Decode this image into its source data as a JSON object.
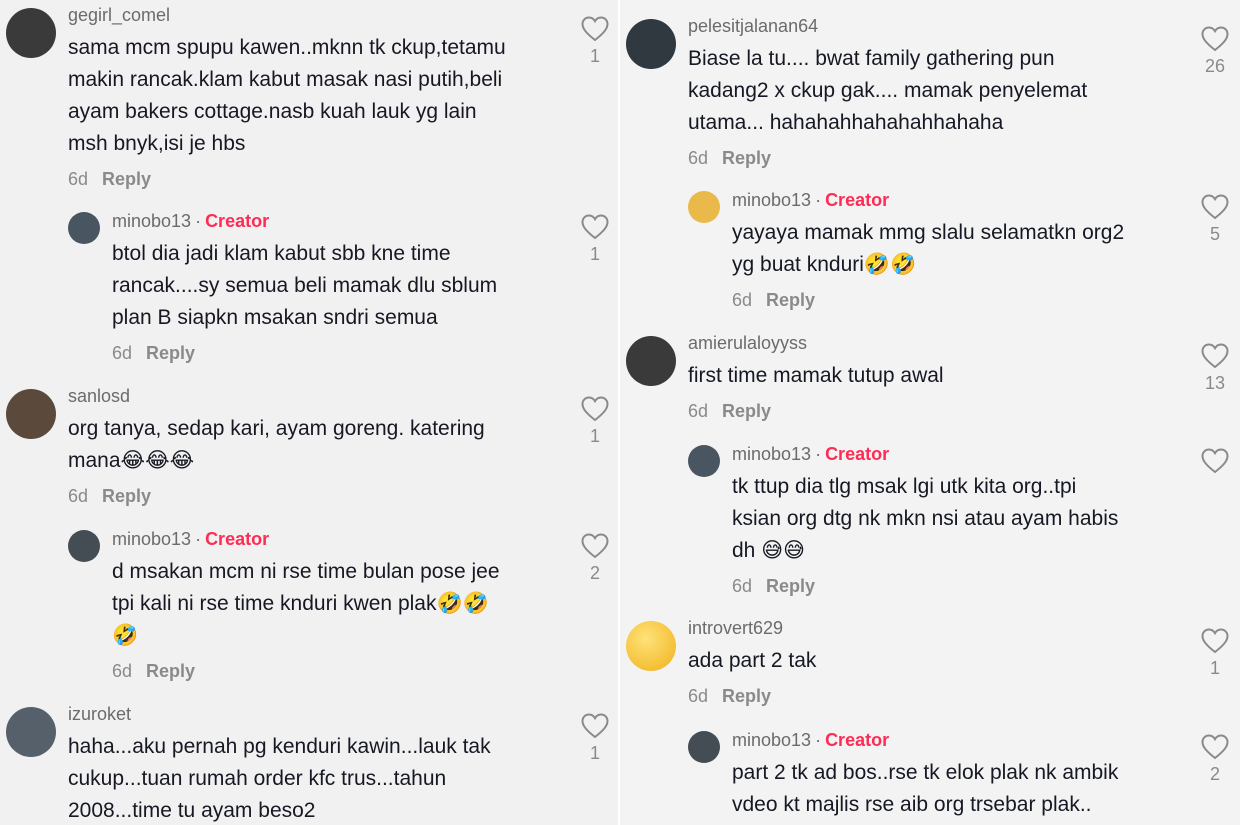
{
  "left": [
    {
      "kind": "top",
      "user": "gegirl_comel",
      "text": "sama mcm spupu kawen..mknn tk ckup,tetamu\nmakin rancak.klam kabut masak nasi putih,beli\nayam bakers cottage.nasb kuah lauk yg lain\nmsh bnyk,isi je hbs",
      "age": "6d",
      "reply": "Reply",
      "likes": "1"
    },
    {
      "kind": "reply",
      "user": "minobo13",
      "creator": "Creator",
      "text": "btol dia jadi klam kabut sbb kne time\nrancak....sy semua beli mamak dlu sblum\nplan B siapkn msakan sndri semua",
      "age": "6d",
      "reply": "Reply",
      "likes": "1"
    },
    {
      "kind": "top",
      "user": "sanlosd",
      "text": "org tanya, sedap kari, ayam goreng. katering\nmana",
      "emoji": "😂😂😂",
      "age": "6d",
      "reply": "Reply",
      "likes": "1"
    },
    {
      "kind": "reply",
      "user": "minobo13",
      "creator": "Creator",
      "text": "d msakan mcm ni rse time bulan pose jee\ntpi kali ni rse time knduri kwen plak",
      "emoji": "🤣🤣\n🤣",
      "age": "6d",
      "reply": "Reply",
      "likes": "2"
    },
    {
      "kind": "top",
      "user": "izuroket",
      "text": "haha...aku pernah pg kenduri kawin...lauk tak\ncukup...tuan rumah order kfc trus...tahun\n2008...time tu ayam beso2",
      "likes": "1"
    }
  ],
  "right": [
    {
      "kind": "top",
      "user": "pelesitjalanan64",
      "text": "Biase la tu.... bwat family gathering pun\nkadang2 x ckup gak.... mamak penyelemat\nutama... hahahahhahahahhahaha",
      "age": "6d",
      "reply": "Reply",
      "likes": "26"
    },
    {
      "kind": "reply",
      "user": "minobo13",
      "creator": "Creator",
      "text": "yayaya mamak mmg slalu selamatkn org2\nyg buat knduri",
      "emoji": "🤣🤣",
      "age": "6d",
      "reply": "Reply",
      "likes": "5"
    },
    {
      "kind": "top",
      "user": "amierulaloyyss",
      "text": "first time mamak tutup awal",
      "age": "6d",
      "reply": "Reply",
      "likes": "13"
    },
    {
      "kind": "reply",
      "user": "minobo13",
      "creator": "Creator",
      "text": "tk ttup dia tlg msak lgi utk kita org..tpi\nksian org dtg nk mkn nsi atau ayam habis\ndh ",
      "emoji": "😅😅",
      "age": "6d",
      "reply": "Reply",
      "likes": ""
    },
    {
      "kind": "top",
      "user": "introvert629",
      "text": "ada part 2 tak",
      "age": "6d",
      "reply": "Reply",
      "likes": "1"
    },
    {
      "kind": "reply",
      "user": "minobo13",
      "creator": "Creator",
      "text": "part 2 tk ad bos..rse tk elok plak nk ambik\nvdeo kt majlis rse aib org trsebar plak..",
      "likes": "2"
    }
  ],
  "colors": {
    "creator": "#fe2c55",
    "meta": "#8a8a8a",
    "username": "#6b6b6b"
  },
  "icons": {
    "like": "heart-outline-icon"
  }
}
